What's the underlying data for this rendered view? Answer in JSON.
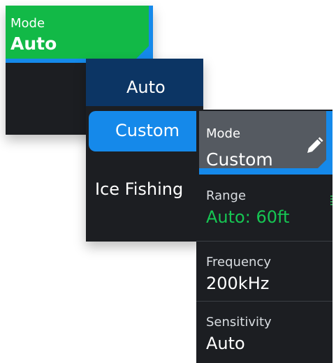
{
  "panel1": {
    "mode_label": "Mode",
    "mode_value": "Auto"
  },
  "mode_menu": {
    "items": [
      {
        "label": "Auto"
      },
      {
        "label": "Custom"
      },
      {
        "label": "Ice Fishing"
      }
    ]
  },
  "settings": {
    "mode": {
      "label": "Mode",
      "value": "Custom",
      "icon": "pencil-icon"
    },
    "range": {
      "label": "Range",
      "value": "Auto: 60ft"
    },
    "frequency": {
      "label": "Frequency",
      "value": "200kHz"
    },
    "sensitivity": {
      "label": "Sensitivity",
      "value": "Auto"
    }
  },
  "colors": {
    "selected_blue": "#1589ea",
    "active_green": "#12b947",
    "panel_dark": "#1c1e22",
    "value_green": "#16c653"
  }
}
